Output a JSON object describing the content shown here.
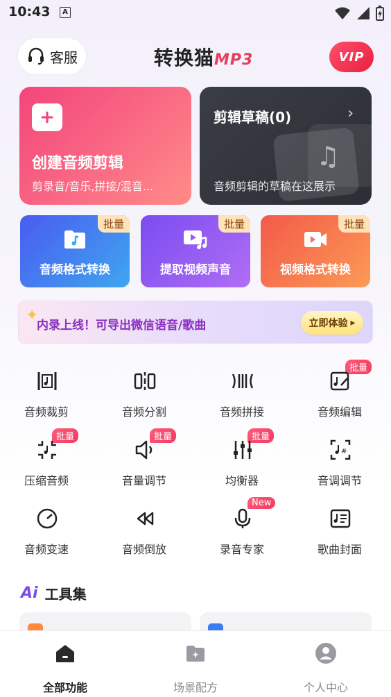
{
  "status_bar": {
    "time": "10:43",
    "notif_letter": "A"
  },
  "header": {
    "service_label": "客服",
    "logo_text": "转换猫",
    "logo_suffix": "MP3",
    "vip_label": "VIP"
  },
  "create_card": {
    "title": "创建音频剪辑",
    "subtitle": "剪录音/音乐,拼接/混音..."
  },
  "draft_card": {
    "title": "剪辑草稿(0)",
    "subtitle": "音频剪辑的草稿在这展示"
  },
  "format_cards": [
    {
      "label": "音频格式转换",
      "badge": "批量",
      "icon": "audio-file-icon"
    },
    {
      "label": "提取视频声音",
      "badge": "批量",
      "icon": "video-music-icon"
    },
    {
      "label": "视频格式转换",
      "badge": "批量",
      "icon": "video-camera-icon"
    }
  ],
  "banner": {
    "text": "内录上线！可导出微信语音/歌曲",
    "button": "立即体验"
  },
  "tools": [
    {
      "label": "音频裁剪",
      "badge": ""
    },
    {
      "label": "音频分割",
      "badge": ""
    },
    {
      "label": "音频拼接",
      "badge": ""
    },
    {
      "label": "音频编辑",
      "badge": "批量"
    },
    {
      "label": "压缩音频",
      "badge": "批量"
    },
    {
      "label": "音量调节",
      "badge": "批量"
    },
    {
      "label": "均衡器",
      "badge": "批量"
    },
    {
      "label": "音调调节",
      "badge": ""
    },
    {
      "label": "音频变速",
      "badge": ""
    },
    {
      "label": "音频倒放",
      "badge": ""
    },
    {
      "label": "录音专家",
      "badge": "New"
    },
    {
      "label": "歌曲封面",
      "badge": ""
    }
  ],
  "ai_section": {
    "mark": "Ai",
    "title": "工具集"
  },
  "bottom_nav": [
    {
      "label": "全部功能"
    },
    {
      "label": "场景配方"
    },
    {
      "label": "个人中心"
    }
  ],
  "colors": {
    "accent_pink": "#f3457a",
    "vip_red": "#e8213f",
    "badge_pink": "#f03c62"
  }
}
